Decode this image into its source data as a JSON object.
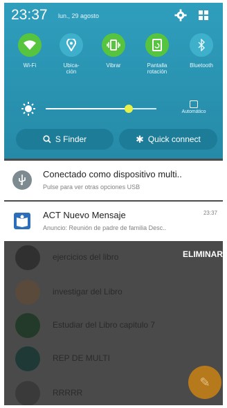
{
  "status_bar": {
    "time": "23:37",
    "date": "lun., 29 agosto"
  },
  "toggles": [
    {
      "label": "Wi-Fi",
      "icon": "wifi-icon",
      "on": true
    },
    {
      "label": "Ubica-\nción",
      "icon": "location-icon",
      "on": false
    },
    {
      "label": "Vibrar",
      "icon": "vibrate-icon",
      "on": true
    },
    {
      "label": "Pantalla\nrotación",
      "icon": "rotation-icon",
      "on": true
    },
    {
      "label": "Bluetooth",
      "icon": "bluetooth-icon",
      "on": false
    }
  ],
  "brightness": {
    "level": 0.75,
    "auto_label": "Automático"
  },
  "quick_buttons": {
    "sfinder": "S Finder",
    "quick_connect": "Quick connect"
  },
  "notifications": [
    {
      "title": "Conectado como dispositivo multi..",
      "subtitle": "Pulse para ver otras opciones USB",
      "time": ""
    },
    {
      "title": "ACT Nuevo Mensaje",
      "subtitle": "Anuncio: Reunión de padre de familia Desc..",
      "time": "23:37"
    }
  ],
  "background_list": {
    "items": [
      "ejercicios del libro",
      "investigar del Libro",
      "Estudiar del Libro capitulo 7",
      "REP DE MULTI",
      "RRRRR"
    ],
    "delete_label": "ELIMINAR"
  },
  "colors": {
    "shade": "#258aa7",
    "toggle_on": "#57c43f",
    "toggle_off": "#3fb0cc",
    "fab": "#b6791b"
  }
}
